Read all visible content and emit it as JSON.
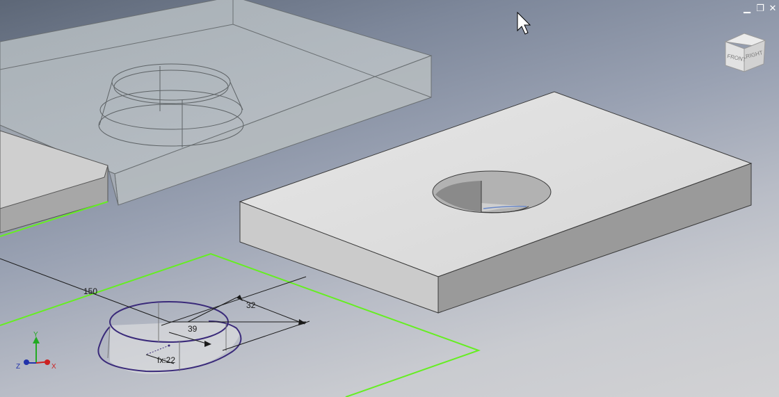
{
  "window_controls": {
    "minimize": "▁",
    "restore": "❐",
    "close": "✕"
  },
  "view_cube": {
    "front_label": "FRONT",
    "right_label": "RIGHT"
  },
  "dimensions": {
    "d1": "150",
    "d2": "32",
    "d3": "39",
    "d4": "fx:22"
  },
  "triad": {
    "x_label": "X",
    "y_label": "Y",
    "z_label": "Z"
  },
  "colors": {
    "sketch_profile": "#3a2a7a",
    "plane_outline": "#66ee22",
    "part_face": "#dcdcdc"
  }
}
